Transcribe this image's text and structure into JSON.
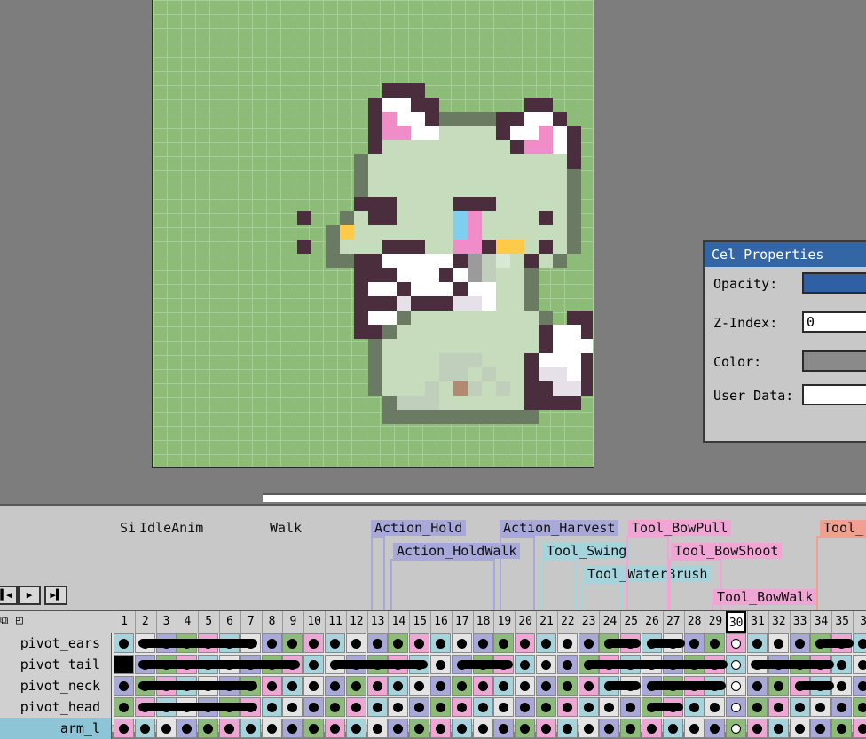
{
  "cel_properties": {
    "title": "Cel Properties",
    "opacity_label": "Opacity:",
    "zindex_label": "Z-Index:",
    "zindex_value": "0",
    "color_label": "Color:",
    "userdata_label": "User Data:"
  },
  "tags": [
    {
      "label": "Sit",
      "color": "#c8c8c8"
    },
    {
      "label": "IdleAnim",
      "color": "#c8c8c8"
    },
    {
      "label": "Walk",
      "color": "#c8c8c8"
    },
    {
      "label": "Action_Hold",
      "color": "#a9a9d9"
    },
    {
      "label": "Action_HoldWalk",
      "color": "#a9a9d9"
    },
    {
      "label": "Action_Harvest",
      "color": "#a9a9d9"
    },
    {
      "label": "Tool_Swing",
      "color": "#a6d4dc"
    },
    {
      "label": "Tool_WaterBrush",
      "color": "#a6d4dc"
    },
    {
      "label": "Tool_BowPull",
      "color": "#f0a6d4"
    },
    {
      "label": "Tool_BowShoot",
      "color": "#f0a6d4"
    },
    {
      "label": "Tool_BowWalk",
      "color": "#f0a6d4"
    },
    {
      "label": "Tool_",
      "color": "#f0a090"
    }
  ],
  "playback": {
    "first_icon": "first-frame-icon",
    "play_icon": "play-icon",
    "last_icon": "last-frame-icon"
  },
  "frames": [
    "1",
    "2",
    "3",
    "4",
    "5",
    "6",
    "7",
    "8",
    "9",
    "10",
    "11",
    "12",
    "13",
    "14",
    "15",
    "16",
    "17",
    "18",
    "19",
    "20",
    "21",
    "22",
    "23",
    "24",
    "25",
    "26",
    "27",
    "28",
    "29",
    "30",
    "31",
    "32",
    "33",
    "34",
    "35",
    "3"
  ],
  "current_frame": "30",
  "layers": [
    {
      "name": "pivot_ears"
    },
    {
      "name": "pivot_tail"
    },
    {
      "name": "pivot_neck"
    },
    {
      "name": "pivot_head"
    },
    {
      "name": "arm_l"
    }
  ],
  "colors": {
    "canvas_bg": "#8cbc78",
    "title_bar": "#3465a4",
    "timeline_bg": "#c8c8c8"
  }
}
